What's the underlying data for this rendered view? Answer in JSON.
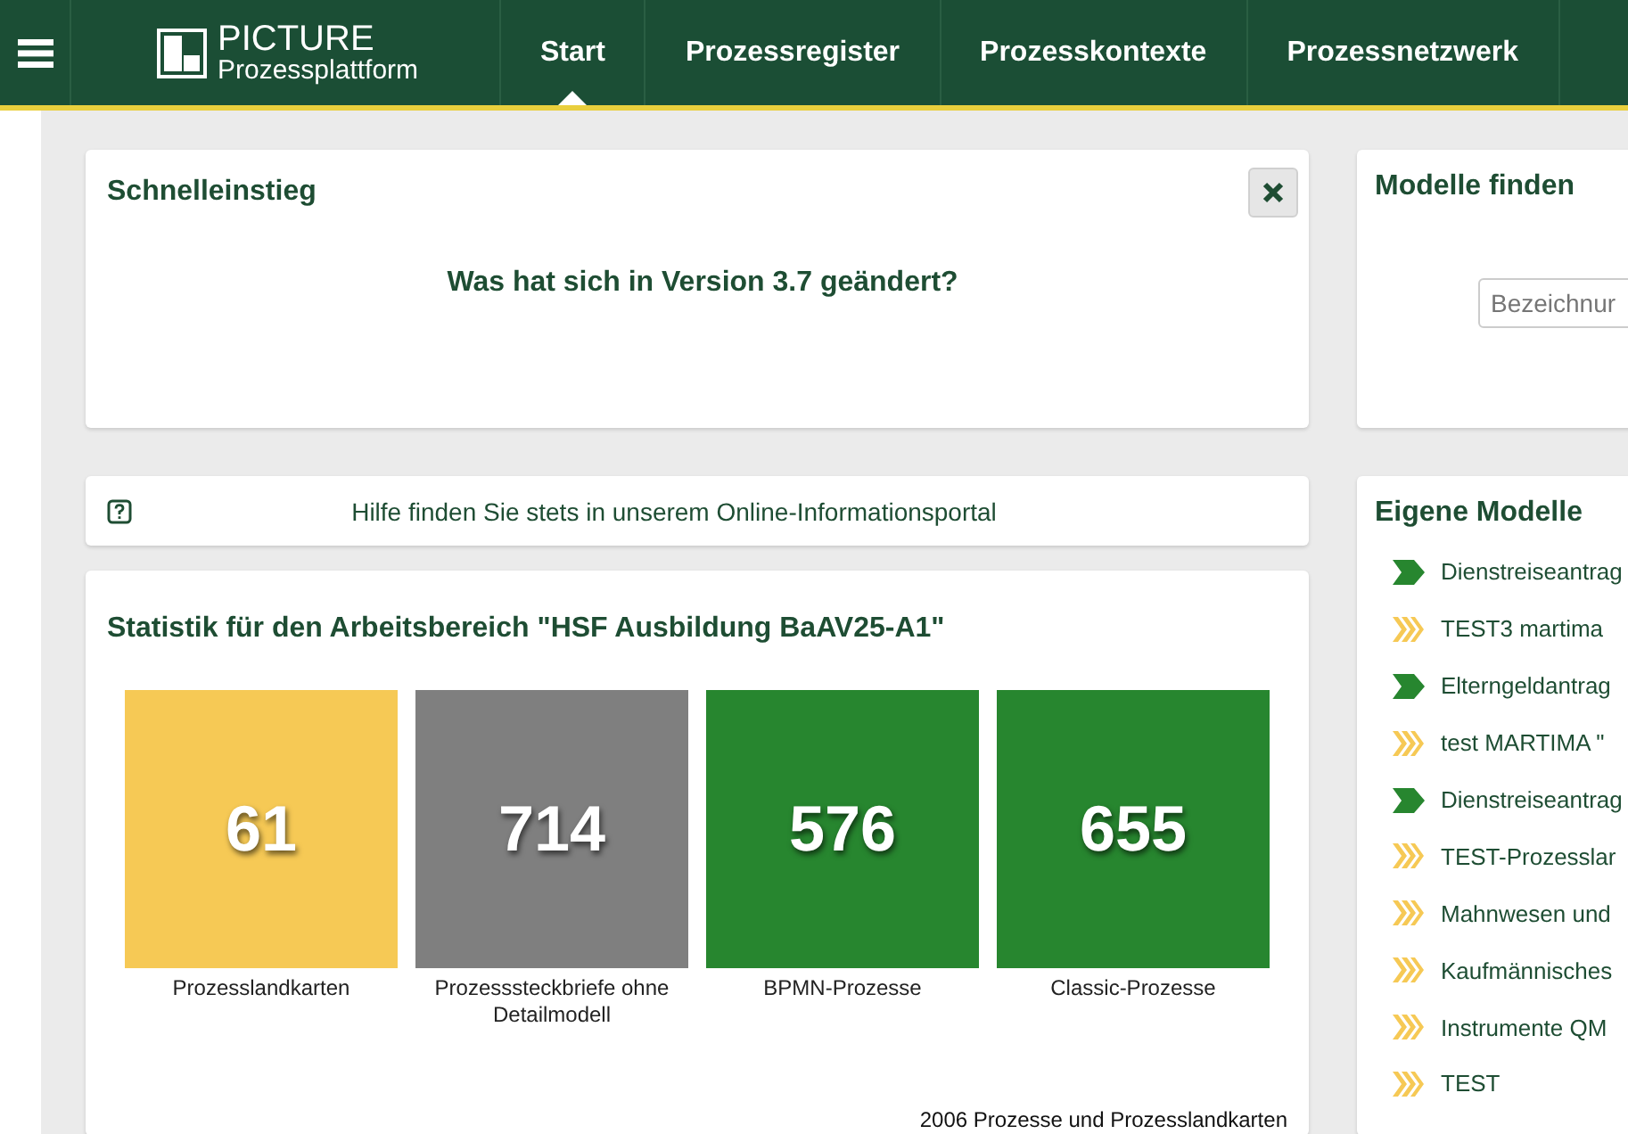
{
  "header": {
    "logo": {
      "title": "PICTURE",
      "subtitle": "Prozessplattform"
    },
    "tabs": [
      {
        "label": "Start",
        "selected": true
      },
      {
        "label": "Prozessregister",
        "selected": false
      },
      {
        "label": "Prozesskontexte",
        "selected": false
      },
      {
        "label": "Prozessnetzwerk",
        "selected": false
      }
    ]
  },
  "quick_start": {
    "title": "Schnelleinstieg",
    "link": "Was hat sich in Version 3.7 geändert?"
  },
  "help": {
    "text": "Hilfe finden Sie stets in unserem Online-Informationsportal"
  },
  "statistics": {
    "title": "Statistik für den Arbeitsbereich \"HSF Ausbildung BaAV25-A1\"",
    "tiles": [
      {
        "value": "61",
        "label": "Prozesslandkarten",
        "color": "#f6c955"
      },
      {
        "value": "714",
        "label": "Prozesssteckbriefe ohne Detailmodell",
        "color": "#7f7f7f"
      },
      {
        "value": "576",
        "label": "BPMN-Prozesse",
        "color": "#27862f"
      },
      {
        "value": "655",
        "label": "Classic-Prozesse",
        "color": "#27862f"
      }
    ],
    "total": "2006 Prozesse und Prozesslandkarten"
  },
  "find_models": {
    "title": "Modelle finden",
    "search": {
      "placeholder": "Bezeichnur"
    }
  },
  "own_models": {
    "title": "Eigene Modelle",
    "items": [
      {
        "label": "Dienstreiseantrag",
        "kind": "process"
      },
      {
        "label": "TEST3 martima",
        "kind": "map"
      },
      {
        "label": "Elterngeldantrag",
        "kind": "process"
      },
      {
        "label": "test MARTIMA \"",
        "kind": "map"
      },
      {
        "label": "Dienstreiseantrag",
        "kind": "process"
      },
      {
        "label": "TEST-Prozesslar",
        "kind": "map"
      },
      {
        "label": "Mahnwesen und",
        "kind": "map"
      },
      {
        "label": "Kaufmännisches",
        "kind": "map"
      },
      {
        "label": "Instrumente QM",
        "kind": "map"
      },
      {
        "label": "TEST",
        "kind": "map"
      }
    ]
  }
}
